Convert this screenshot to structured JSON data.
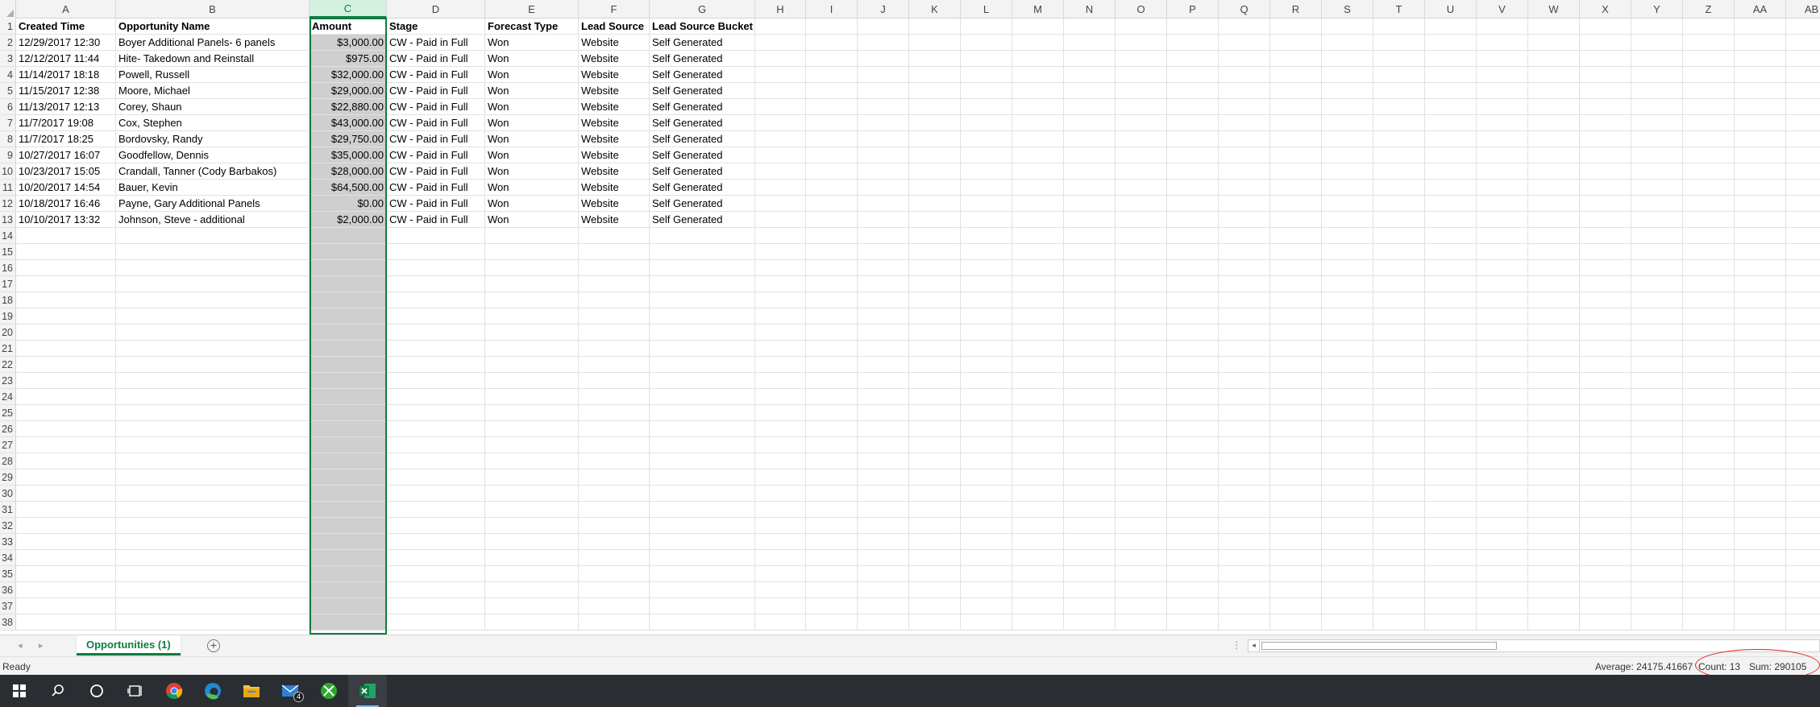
{
  "app": {
    "accent": "#107c41"
  },
  "columns": [
    {
      "letter": "A",
      "w": 124
    },
    {
      "letter": "B",
      "w": 240
    },
    {
      "letter": "C",
      "w": 96
    },
    {
      "letter": "D",
      "w": 122
    },
    {
      "letter": "E",
      "w": 116
    },
    {
      "letter": "F",
      "w": 88
    },
    {
      "letter": "G",
      "w": 131
    },
    {
      "letter": "H",
      "w": 63
    },
    {
      "letter": "I",
      "w": 64
    },
    {
      "letter": "J",
      "w": 64
    },
    {
      "letter": "K",
      "w": 64
    },
    {
      "letter": "L",
      "w": 64
    },
    {
      "letter": "M",
      "w": 64
    },
    {
      "letter": "N",
      "w": 64
    },
    {
      "letter": "O",
      "w": 64
    },
    {
      "letter": "P",
      "w": 64
    },
    {
      "letter": "Q",
      "w": 64
    },
    {
      "letter": "R",
      "w": 64
    },
    {
      "letter": "S",
      "w": 64
    },
    {
      "letter": "T",
      "w": 64
    },
    {
      "letter": "U",
      "w": 64
    },
    {
      "letter": "V",
      "w": 64
    },
    {
      "letter": "W",
      "w": 64
    },
    {
      "letter": "X",
      "w": 64
    },
    {
      "letter": "Y",
      "w": 64
    },
    {
      "letter": "Z",
      "w": 64
    },
    {
      "letter": "AA",
      "w": 64
    },
    {
      "letter": "AB",
      "w": 64
    }
  ],
  "selected_column": "C",
  "header_row": [
    "Created Time",
    "Opportunity Name",
    "Amount",
    "Stage",
    "Forecast Type",
    "Lead Source",
    "Lead Source Bucket"
  ],
  "data_rows": [
    [
      "12/29/2017 12:30",
      "Boyer Additional Panels- 6 panels",
      "$3,000.00",
      "CW - Paid in Full",
      "Won",
      "Website",
      "Self Generated"
    ],
    [
      "12/12/2017 11:44",
      "Hite- Takedown and Reinstall",
      "$975.00",
      "CW - Paid in Full",
      "Won",
      "Website",
      "Self Generated"
    ],
    [
      "11/14/2017 18:18",
      "Powell, Russell",
      "$32,000.00",
      "CW - Paid in Full",
      "Won",
      "Website",
      "Self Generated"
    ],
    [
      "11/15/2017 12:38",
      "Moore, Michael",
      "$29,000.00",
      "CW - Paid in Full",
      "Won",
      "Website",
      "Self Generated"
    ],
    [
      "11/13/2017 12:13",
      "Corey, Shaun",
      "$22,880.00",
      "CW - Paid in Full",
      "Won",
      "Website",
      "Self Generated"
    ],
    [
      "11/7/2017 19:08",
      "Cox, Stephen",
      "$43,000.00",
      "CW - Paid in Full",
      "Won",
      "Website",
      "Self Generated"
    ],
    [
      "11/7/2017 18:25",
      "Bordovsky, Randy",
      "$29,750.00",
      "CW - Paid in Full",
      "Won",
      "Website",
      "Self Generated"
    ],
    [
      "10/27/2017 16:07",
      "Goodfellow, Dennis",
      "$35,000.00",
      "CW - Paid in Full",
      "Won",
      "Website",
      "Self Generated"
    ],
    [
      "10/23/2017 15:05",
      "Crandall, Tanner (Cody Barbakos)",
      "$28,000.00",
      "CW - Paid in Full",
      "Won",
      "Website",
      "Self Generated"
    ],
    [
      "10/20/2017 14:54",
      "Bauer, Kevin",
      "$64,500.00",
      "CW - Paid in Full",
      "Won",
      "Website",
      "Self Generated"
    ],
    [
      "10/18/2017 16:46",
      "Payne, Gary Additional Panels",
      "$0.00",
      "CW - Paid in Full",
      "Won",
      "Website",
      "Self Generated"
    ],
    [
      "10/10/2017 13:32",
      "Johnson, Steve - additional",
      "$2,000.00",
      "CW - Paid in Full",
      "Won",
      "Website",
      "Self Generated"
    ]
  ],
  "total_rows": 38,
  "sheet_tab": {
    "label": "Opportunities (1)"
  },
  "status": {
    "ready": "Ready",
    "average": "Average: 24175.41667",
    "count": "Count: 13",
    "sum": "Sum: 290105"
  },
  "taskbar": [
    {
      "name": "windows-start-icon"
    },
    {
      "name": "search-icon"
    },
    {
      "name": "cortana-icon"
    },
    {
      "name": "task-view-icon"
    },
    {
      "name": "chrome-icon"
    },
    {
      "name": "edge-icon"
    },
    {
      "name": "file-explorer-icon"
    },
    {
      "name": "mail-icon",
      "badge": "4"
    },
    {
      "name": "xbox-icon"
    },
    {
      "name": "excel-icon",
      "active": true
    }
  ]
}
